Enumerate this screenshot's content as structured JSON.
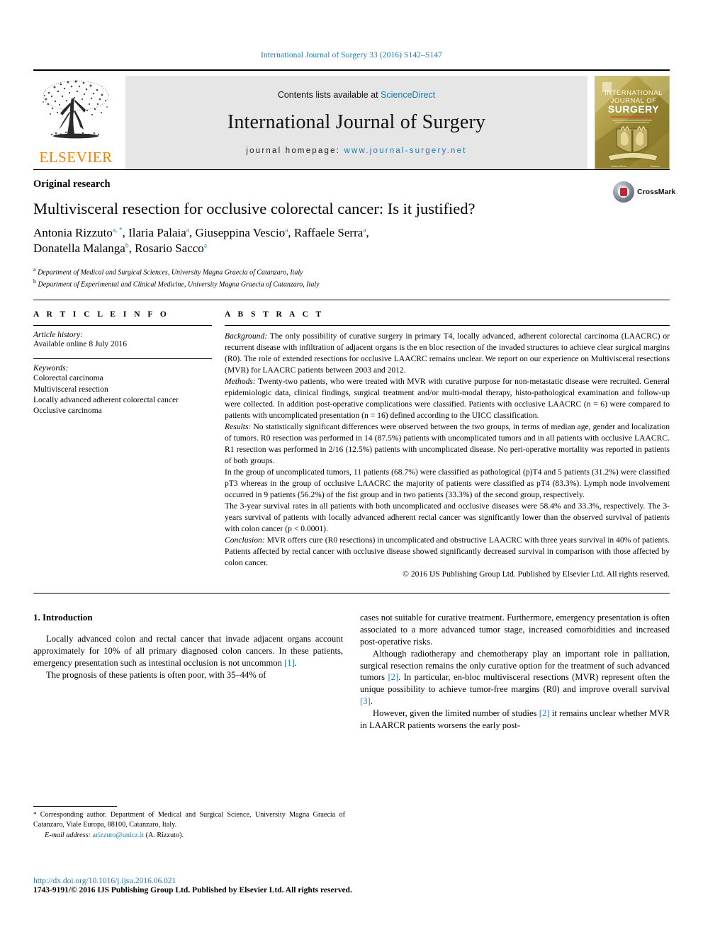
{
  "running_head": "International Journal of Surgery 33 (2016) S142–S147",
  "masthead": {
    "publisher": "ELSEVIER",
    "contents_prefix": "Contents lists available at ",
    "contents_link": "ScienceDirect",
    "journal_title": "International Journal of Surgery",
    "homepage_prefix": "journal homepage: ",
    "homepage_url": "www.journal-surgery.net",
    "cover_line1": "INTERNATIONAL",
    "cover_line2": "JOURNAL OF",
    "cover_line3": "SURGERY"
  },
  "article": {
    "type": "Original research",
    "title": "Multivisceral resection for occlusive colorectal cancer: Is it justified?",
    "authors_line1": "Antonia Rizzuto",
    "authors": [
      {
        "name": "Antonia Rizzuto",
        "sup": "a, *"
      },
      {
        "name": "Ilaria Palaia",
        "sup": "a"
      },
      {
        "name": "Giuseppina Vescio",
        "sup": "a"
      },
      {
        "name": "Raffaele Serra",
        "sup": "a"
      },
      {
        "name": "Donatella Malanga",
        "sup": "b"
      },
      {
        "name": "Rosario Sacco",
        "sup": "a"
      }
    ],
    "affiliations": [
      {
        "sup": "a",
        "text": "Department of Medical and Surgical Sciences, University Magna Graecia of Catanzaro, Italy"
      },
      {
        "sup": "b",
        "text": "Department of Experimental and Clinical Medicine, University Magna Graecia of Catanzaro, Italy"
      }
    ],
    "crossmark_label": "CrossMark"
  },
  "article_info": {
    "heading": "A R T I C L E  I N F O",
    "history_label": "Article history:",
    "history_value": "Available online 8 July 2016",
    "keywords_label": "Keywords:",
    "keywords": [
      "Colorectal carcinoma",
      "Multivisceral resection",
      "Locally advanced adherent colorectal cancer",
      "Occlusive carcinoma"
    ]
  },
  "abstract": {
    "heading": "A B S T R A C T",
    "background_label": "Background:",
    "background_text": " The only possibility of curative surgery in primary T4, locally advanced, adherent colorectal carcinoma (LAACRC) or recurrent disease with infiltration of adjacent organs is the en bloc resection of the invaded structures to achieve clear surgical margins (R0). The role of extended resections for occlusive LAACRC remains unclear. We report on our experience on Multivisceral resections (MVR) for LAACRC patients between 2003 and 2012.",
    "methods_label": "Methods:",
    "methods_text": " Twenty-two patients, who were treated with MVR with curative purpose for non-metastatic disease were recruited. General epidemiologic data, clinical findings, surgical treatment and/or multi-modal therapy, histo-pathological examination and follow-up were collected. In addition post-operative complications were classified. Patients with occlusive LAACRC (n = 6) were compared to patients with uncomplicated presentation (n = 16) defined according to the UICC classification.",
    "results_label": "Results:",
    "results_text": " No statistically significant differences were observed between the two groups, in terms of median age, gender and localization of tumors. R0 resection was performed in 14 (87.5%) patients with uncomplicated tumors and in all patients with occlusive LAACRC. R1 resection was performed in 2/16 (12.5%) patients with uncomplicated disease. No peri-operative mortality was reported in patients of both groups.",
    "results_para2": "In the group of uncomplicated tumors, 11 patients (68.7%) were classified as pathological (p)T4 and 5 patients (31.2%) were classified pT3 whereas in the group of occlusive LAACRC the majority of patients were classified as pT4 (83.3%). Lymph node involvement occurred in 9 patients (56.2%) of the fist group and in two patients (33.3%) of the second group, respectively.",
    "results_para3": "The 3-year survival rates in all patients with both uncomplicated and occlusive diseases were 58.4% and 33.3%, respectively. The 3-years survival of patients with locally advanced adherent rectal cancer was significantly lower than the observed survival of patients with colon cancer (p < 0.0001).",
    "conclusion_label": "Conclusion:",
    "conclusion_text": " MVR offers cure (R0 resections) in uncomplicated and obstructive LAACRC with three years survival in 40% of patients. Patients affected by rectal cancer with occlusive disease showed significantly decreased survival in comparison with those affected by colon cancer.",
    "copyright": "© 2016 IJS Publishing Group Ltd. Published by Elsevier Ltd. All rights reserved."
  },
  "body": {
    "section_heading": "1. Introduction",
    "left_para1": "Locally advanced colon and rectal cancer that invade adjacent organs account approximately for 10% of all primary diagnosed colon cancers. In these patients, emergency presentation such as intestinal occlusion is not uncommon ",
    "left_para1_ref": "[1]",
    "left_para1_end": ".",
    "left_para2": "The prognosis of these patients is often poor, with 35–44% of",
    "right_para1_cont": "cases not suitable for curative treatment. Furthermore, emergency presentation is often associated to a more advanced tumor stage, increased comorbidities and increased post-operative risks.",
    "right_para2_a": "Although radiotherapy and chemotherapy play an important role in palliation, surgical resection remains the only curative option for the treatment of such advanced tumors ",
    "right_para2_ref1": "[2]",
    "right_para2_b": ". In particular, en-bloc multivisceral resections (MVR) represent often the unique possibility to achieve tumor-free margins (R0) and improve overall survival ",
    "right_para2_ref2": "[3]",
    "right_para2_c": ".",
    "right_para3_a": "However, given the limited number of studies ",
    "right_para3_ref": "[2]",
    "right_para3_b": " it remains unclear whether MVR in LAARCR patients worsens the early post-"
  },
  "footnotes": {
    "corresponding_star": "*",
    "corresponding": " Corresponding author. Department of Medical and Surgical Science, University Magna Graecia of Catanzaro, Viale Europa, 88100, Catanzaro, Italy.",
    "email_label": "E-mail address:",
    "email": "arizzuto@unicz.it",
    "email_owner": " (A. Rizzuto).",
    "doi": "http://dx.doi.org/10.1016/j.ijsu.2016.06.021",
    "issn_line": "1743-9191/© 2016 IJS Publishing Group Ltd. Published by Elsevier Ltd. All rights reserved."
  },
  "colors": {
    "link_blue": "#1b7bb5",
    "elsevier_orange": "#ef8200",
    "band_gray": "#e6e6e6",
    "crossmark_red": "#c1272d"
  }
}
